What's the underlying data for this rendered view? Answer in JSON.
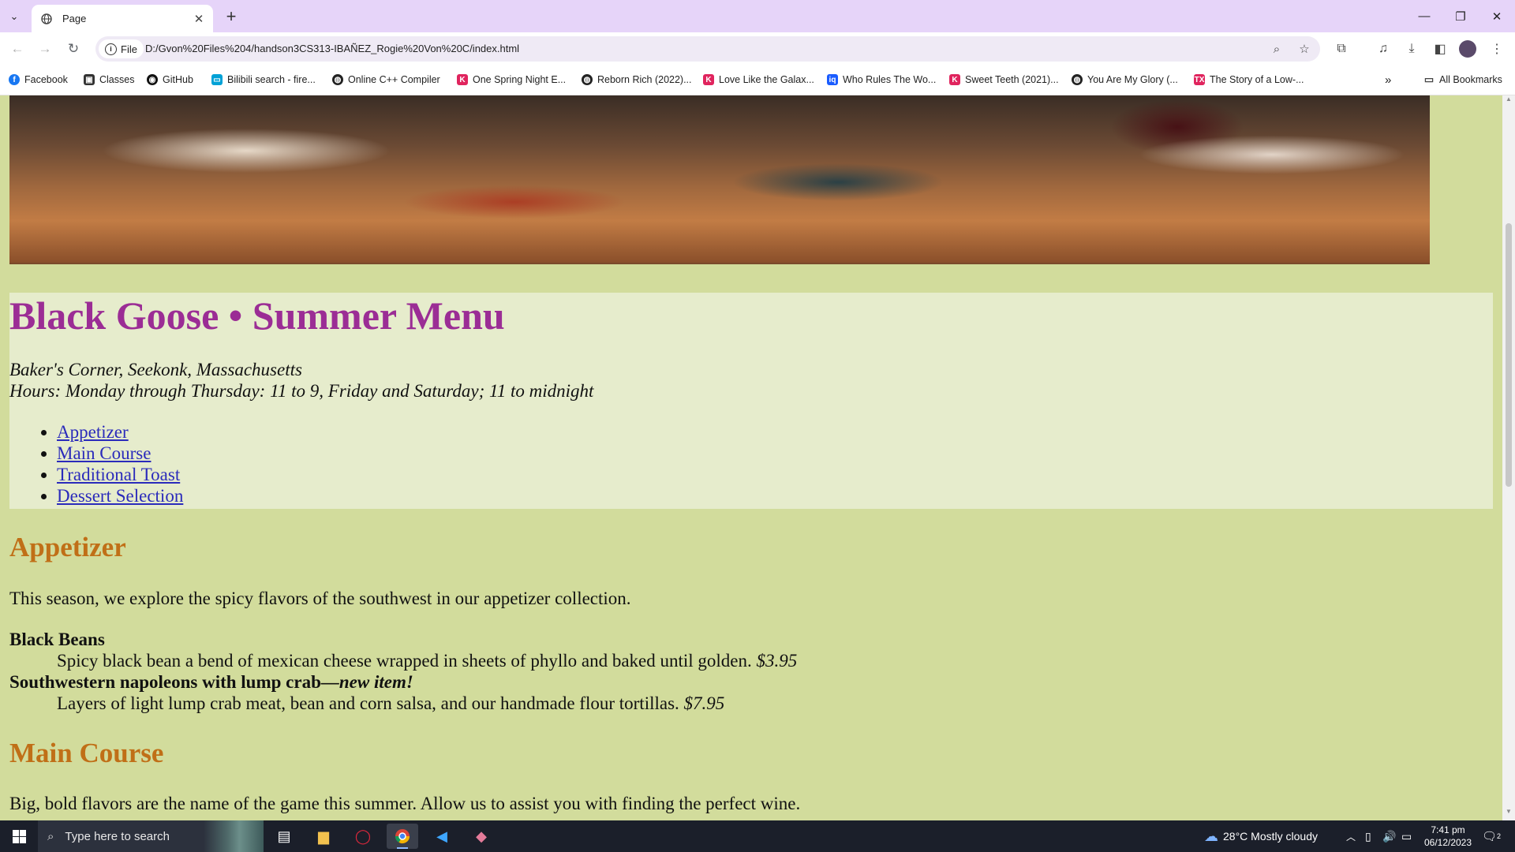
{
  "browser": {
    "tab": {
      "title": "Page"
    },
    "address": {
      "chip_label": "File",
      "url": "D:/Gvon%20Files%204/handson3CS313-IBAÑEZ_Rogie%20Von%20C/index.html"
    },
    "bookmarks": [
      {
        "label": "Facebook",
        "icon": "facebook-icon",
        "color": "#1877f2"
      },
      {
        "label": "Classes",
        "icon": "classes-icon",
        "color": "#333333"
      },
      {
        "label": "GitHub",
        "icon": "github-icon",
        "color": "#111111"
      },
      {
        "label": "Bilibili search - fire...",
        "icon": "bilibili-icon",
        "color": "#00a1d6"
      },
      {
        "label": "Online C++ Compiler",
        "icon": "globe-icon",
        "color": "#222222"
      },
      {
        "label": "One Spring Night E...",
        "icon": "kissasian-icon",
        "color": "#e0245e"
      },
      {
        "label": "Reborn Rich (2022)...",
        "icon": "globe-icon",
        "color": "#222222"
      },
      {
        "label": "Love Like the Galax...",
        "icon": "kissasian-icon",
        "color": "#e0245e"
      },
      {
        "label": "Who Rules The Wo...",
        "icon": "iqiyi-icon",
        "color": "#1a5cff"
      },
      {
        "label": "Sweet Teeth (2021)...",
        "icon": "kissasian-icon",
        "color": "#e0245e"
      },
      {
        "label": "You Are My Glory (...",
        "icon": "globe-icon",
        "color": "#222222"
      },
      {
        "label": "The Story of a Low-...",
        "icon": "tx-icon",
        "color": "#e0245e"
      }
    ],
    "all_bookmarks_label": "All Bookmarks"
  },
  "page": {
    "title": "Black Goose • Summer Menu",
    "address_line": "Baker's Corner, Seekonk, Massachusetts",
    "hours_line": "Hours: Monday through Thursday: 11 to 9, Friday and Saturday; 11 to midnight",
    "nav": [
      "Appetizer",
      "Main Course",
      "Traditional Toast",
      "Dessert Selection"
    ],
    "appetizer": {
      "heading": "Appetizer",
      "intro": "This season, we explore the spicy flavors of the southwest in our appetizer collection.",
      "items": [
        {
          "name": "Black Beans",
          "tag": "",
          "description": "Spicy black bean a bend of mexican cheese wrapped in sheets of phyllo and baked until golden.",
          "price": "$3.95"
        },
        {
          "name": "Southwestern napoleons with lump crab",
          "tag": "—new item!",
          "description": "Layers of light lump crab meat, bean and corn salsa, and our handmade flour tortillas.",
          "price": "$7.95"
        }
      ]
    },
    "main_course": {
      "heading": "Main Course",
      "intro": "Big, bold flavors are the name of the game this summer. Allow us to assist you with finding the perfect wine."
    },
    "colors": {
      "heading": "#9b2d95",
      "section": "#c06f17",
      "link": "#2b2bbb",
      "background": "#d2dc9c",
      "header_panel": "#e6eccc"
    }
  },
  "taskbar": {
    "search_placeholder": "Type here to search",
    "weather": "28°C  Mostly cloudy",
    "time": "7:41 pm",
    "date": "06/12/2023",
    "notification_count": "2"
  }
}
